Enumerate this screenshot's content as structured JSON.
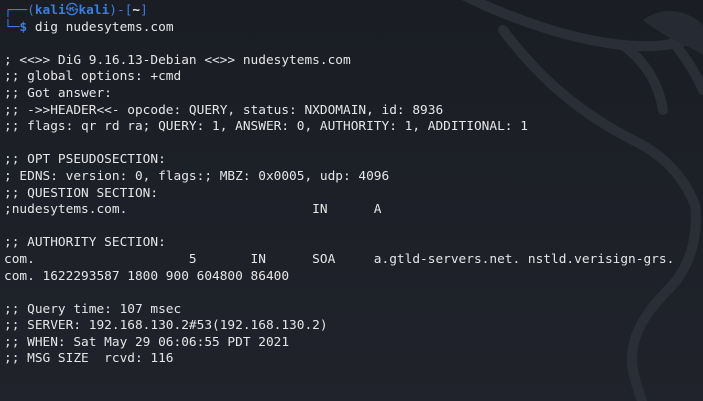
{
  "prompt": {
    "frame_top": "┌──(",
    "user": "kali",
    "at_symbol": "㉿",
    "host": "kali",
    "frame_mid": ")-[",
    "cwd": "~",
    "frame_end": "]",
    "frame_bottom": "└─",
    "dollar": "$ ",
    "command": "dig nudesytems.com"
  },
  "output": [
    "",
    "; <<>> DiG 9.16.13-Debian <<>> nudesytems.com",
    ";; global options: +cmd",
    ";; Got answer:",
    ";; ->>HEADER<<- opcode: QUERY, status: NXDOMAIN, id: 8936",
    ";; flags: qr rd ra; QUERY: 1, ANSWER: 0, AUTHORITY: 1, ADDITIONAL: 1",
    "",
    ";; OPT PSEUDOSECTION:",
    "; EDNS: version: 0, flags:; MBZ: 0x0005, udp: 4096",
    ";; QUESTION SECTION:",
    ";nudesytems.com.                        IN      A",
    "",
    ";; AUTHORITY SECTION:",
    "com.                    5       IN      SOA     a.gtld-servers.net. nstld.verisign-grs.",
    "com. 1622293587 1800 900 604800 86400",
    "",
    ";; Query time: 107 msec",
    ";; SERVER: 192.168.130.2#53(192.168.130.2)",
    ";; WHEN: Sat May 29 06:06:55 PDT 2021",
    ";; MSG SIZE  rcvd: 116"
  ],
  "colors": {
    "background": "#1c1f26",
    "prompt_accent": "#3d7eda",
    "text": "#e6e6e6"
  }
}
